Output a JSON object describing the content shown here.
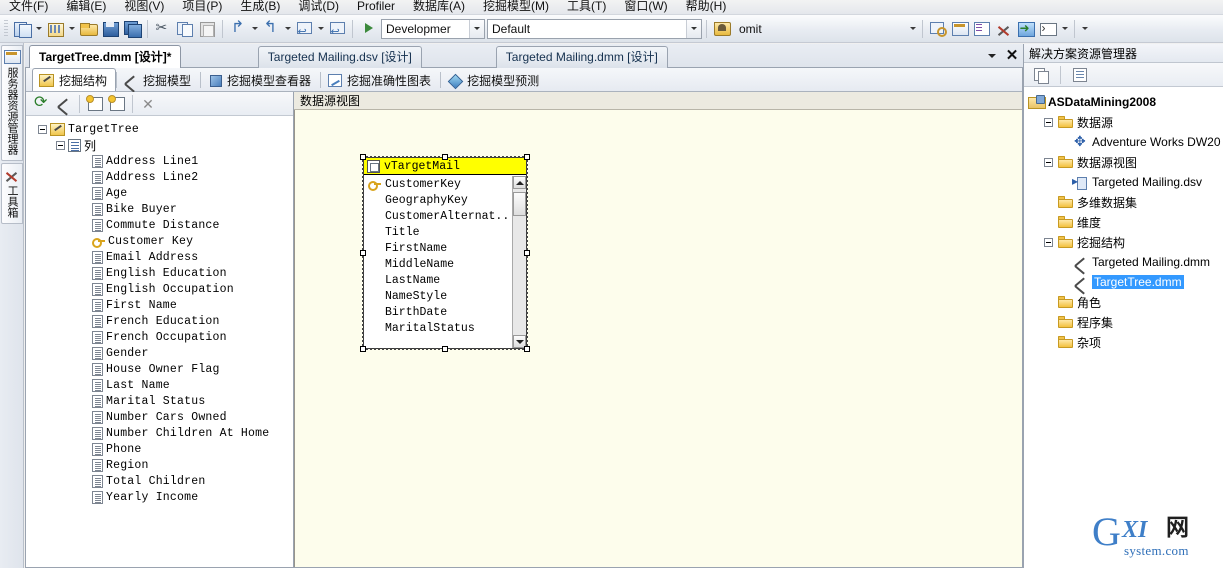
{
  "menu": {
    "items": [
      {
        "label": "文件(F)"
      },
      {
        "label": "编辑(E)"
      },
      {
        "label": "视图(V)"
      },
      {
        "label": "项目(P)"
      },
      {
        "label": "生成(B)"
      },
      {
        "label": "调试(D)"
      },
      {
        "label": "Profiler"
      },
      {
        "label": "数据库(A)"
      },
      {
        "label": "挖掘模型(M)"
      },
      {
        "label": "工具(T)"
      },
      {
        "label": "窗口(W)"
      },
      {
        "label": "帮助(H)"
      }
    ]
  },
  "toolbar": {
    "config_combo": {
      "value": "Developmer",
      "placeholder": "Development"
    },
    "platform_combo": {
      "value": "Default",
      "placeholder": "Default"
    },
    "omit_label": "omit",
    "buttons": [
      {
        "name": "new-project",
        "icon": "new-project-icon"
      },
      {
        "name": "add-new-item",
        "icon": "add-new-item-icon"
      },
      {
        "name": "open-file",
        "icon": "open-folder-icon"
      },
      {
        "name": "save",
        "icon": "save-icon"
      },
      {
        "name": "save-all",
        "icon": "save-all-icon"
      },
      {
        "name": "cut",
        "icon": "scissors-icon"
      },
      {
        "name": "copy",
        "icon": "copy-icon"
      },
      {
        "name": "paste",
        "icon": "paste-icon"
      },
      {
        "name": "undo",
        "icon": "undo-arrow-icon"
      },
      {
        "name": "redo",
        "icon": "redo-arrow-icon"
      },
      {
        "name": "navigate-back",
        "icon": "navigate-back-icon"
      },
      {
        "name": "navigate-forward",
        "icon": "navigate-forward-icon"
      },
      {
        "name": "start-debugging",
        "icon": "play-icon"
      }
    ],
    "right_buttons": [
      {
        "name": "find-in-files",
        "icon": "search-window-icon"
      },
      {
        "name": "solution-explorer",
        "icon": "solution-window-icon"
      },
      {
        "name": "properties-window",
        "icon": "properties-window-icon"
      },
      {
        "name": "toolbox-options",
        "icon": "tools-icon"
      },
      {
        "name": "deploy",
        "icon": "deploy-icon"
      },
      {
        "name": "command-window",
        "icon": "command-window-icon"
      }
    ]
  },
  "left_dock": {
    "tabs": [
      {
        "label": "服务器资源管理器",
        "icon": "server-explorer-icon"
      },
      {
        "label": "工具箱",
        "icon": "toolbox-icon"
      }
    ]
  },
  "document_tabs": {
    "items": [
      {
        "label": "TargetTree.dmm [设计]*",
        "active": true
      },
      {
        "label": "Targeted Mailing.dsv [设计]",
        "active": false
      },
      {
        "label": "Targeted Mailing.dmm [设计]",
        "active": false
      }
    ],
    "controls": {
      "dropdown": "tab-list-dropdown",
      "close": "close-tab-button"
    }
  },
  "designer": {
    "tabs": [
      {
        "label": "挖掘结构",
        "icon": "mining-structure-icon",
        "active": true
      },
      {
        "label": "挖掘模型",
        "icon": "mining-model-icon",
        "active": false
      },
      {
        "label": "挖掘模型查看器",
        "icon": "mining-model-viewer-icon",
        "active": false
      },
      {
        "label": "挖掘准确性图表",
        "icon": "accuracy-chart-icon",
        "active": false
      },
      {
        "label": "挖掘模型预测",
        "icon": "prediction-icon",
        "active": false
      }
    ],
    "tree_toolbar": [
      {
        "name": "refresh-button",
        "icon": "refresh-icon"
      },
      {
        "name": "edit-structure-button",
        "icon": "pickaxe-icon"
      },
      {
        "name": "add-table-button",
        "icon": "add-table-icon"
      },
      {
        "name": "add-column-button",
        "icon": "add-column-icon"
      },
      {
        "name": "delete-button",
        "icon": "close-x-icon"
      }
    ],
    "tree": {
      "root": {
        "label": "TargetTree",
        "icon": "mining-structure-icon"
      },
      "columns_node": {
        "label": "列",
        "icon": "columns-icon"
      },
      "columns": [
        {
          "label": "Address Line1",
          "icon": "column-icon"
        },
        {
          "label": "Address Line2",
          "icon": "column-icon"
        },
        {
          "label": "Age",
          "icon": "column-icon"
        },
        {
          "label": "Bike Buyer",
          "icon": "column-icon"
        },
        {
          "label": "Commute Distance",
          "icon": "column-icon"
        },
        {
          "label": "Customer Key",
          "icon": "key-icon"
        },
        {
          "label": "Email Address",
          "icon": "column-icon"
        },
        {
          "label": "English Education",
          "icon": "column-icon"
        },
        {
          "label": "English Occupation",
          "icon": "column-icon"
        },
        {
          "label": "First Name",
          "icon": "column-icon"
        },
        {
          "label": "French Education",
          "icon": "column-icon"
        },
        {
          "label": "French Occupation",
          "icon": "column-icon"
        },
        {
          "label": "Gender",
          "icon": "column-icon"
        },
        {
          "label": "House Owner Flag",
          "icon": "column-icon"
        },
        {
          "label": "Last Name",
          "icon": "column-icon"
        },
        {
          "label": "Marital Status",
          "icon": "column-icon"
        },
        {
          "label": "Number Cars Owned",
          "icon": "column-icon"
        },
        {
          "label": "Number Children At Home",
          "icon": "column-icon"
        },
        {
          "label": "Phone",
          "icon": "column-icon"
        },
        {
          "label": "Region",
          "icon": "column-icon"
        },
        {
          "label": "Total Children",
          "icon": "column-icon"
        },
        {
          "label": "Yearly Income",
          "icon": "column-icon"
        }
      ]
    },
    "dsv": {
      "header": "数据源视图",
      "table": {
        "title": "vTargetMail",
        "title_bg": "#ffff00",
        "selected": true,
        "rows": [
          {
            "label": "CustomerKey",
            "icon": "key-icon"
          },
          {
            "label": "GeographyKey",
            "icon": "none"
          },
          {
            "label": "CustomerAlternat...",
            "icon": "none"
          },
          {
            "label": "Title",
            "icon": "none"
          },
          {
            "label": "FirstName",
            "icon": "none"
          },
          {
            "label": "MiddleName",
            "icon": "none"
          },
          {
            "label": "LastName",
            "icon": "none"
          },
          {
            "label": "NameStyle",
            "icon": "none"
          },
          {
            "label": "BirthDate",
            "icon": "none"
          },
          {
            "label": "MaritalStatus",
            "icon": "none"
          }
        ]
      }
    }
  },
  "solution_explorer": {
    "title": "解决方案资源管理器",
    "toolbar": [
      {
        "name": "copy-button",
        "icon": "copy-icon"
      },
      {
        "name": "properties-button",
        "icon": "properties-icon"
      }
    ],
    "tree": [
      {
        "label": "ASDataMining2008",
        "icon": "solution-icon",
        "depth": 0,
        "bold": true,
        "expander": false,
        "selected": false
      },
      {
        "label": "数据源",
        "icon": "folder-icon",
        "depth": 1,
        "bold": false,
        "expander": true,
        "selected": false
      },
      {
        "label": "Adventure Works DW20",
        "icon": "data-source-icon",
        "depth": 2,
        "bold": false,
        "expander": false,
        "selected": false
      },
      {
        "label": "数据源视图",
        "icon": "folder-icon",
        "depth": 1,
        "bold": false,
        "expander": true,
        "selected": false
      },
      {
        "label": "Targeted Mailing.dsv",
        "icon": "dsv-icon",
        "depth": 2,
        "bold": false,
        "expander": false,
        "selected": false
      },
      {
        "label": "多维数据集",
        "icon": "folder-icon",
        "depth": 1,
        "bold": false,
        "expander": false,
        "selected": false
      },
      {
        "label": "维度",
        "icon": "folder-icon",
        "depth": 1,
        "bold": false,
        "expander": false,
        "selected": false
      },
      {
        "label": "挖掘结构",
        "icon": "folder-icon",
        "depth": 1,
        "bold": false,
        "expander": true,
        "selected": false
      },
      {
        "label": "Targeted Mailing.dmm",
        "icon": "mining-structure-small-icon",
        "depth": 2,
        "bold": false,
        "expander": false,
        "selected": false
      },
      {
        "label": "TargetTree.dmm",
        "icon": "mining-structure-small-icon",
        "depth": 2,
        "bold": false,
        "expander": false,
        "selected": true
      },
      {
        "label": "角色",
        "icon": "folder-icon",
        "depth": 1,
        "bold": false,
        "expander": false,
        "selected": false
      },
      {
        "label": "程序集",
        "icon": "folder-icon",
        "depth": 1,
        "bold": false,
        "expander": false,
        "selected": false
      },
      {
        "label": "杂项",
        "icon": "folder-icon",
        "depth": 1,
        "bold": false,
        "expander": false,
        "selected": false
      }
    ]
  },
  "watermark": {
    "g": "G",
    "xi": "XI",
    "net": "网",
    "system": "system.com"
  },
  "colors": {
    "selection_blue": "#3399ff",
    "table_title_yellow": "#ffff00",
    "dsv_canvas": "#fdfdec",
    "chrome": "#e8ecf2"
  }
}
